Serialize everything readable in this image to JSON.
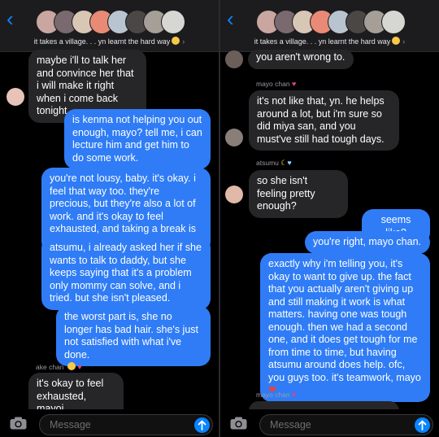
{
  "left": {
    "header": {
      "title": "it takes a village. . . yn learnt the hard way"
    },
    "messages": [
      "maybe i'll to talk her and convince her that i will make it right when i come back tonight.",
      "is kenma not helping you out enough, mayo? tell me, i can lecture him and get him to do some work.",
      "you're not lousy, baby. it's okay. i feel that way too. they're precious, but they're also a lot of work. and it's okay to feel exhausted, and taking a break is also okay.",
      "atsumu, i already asked her if she wants to talk to daddy, but she keeps saying that it's a problem only mommy can solve, and i tried. but she isn't pleased.",
      "the worst part is, she no longer has bad hair. she's just not satisfied with what i've done.",
      "it's okay to feel exhausted, mayoi."
    ],
    "senders": {
      "ake": "ake chan"
    },
    "composer": {
      "placeholder": "Message"
    }
  },
  "right": {
    "header": {
      "title": "it takes a village. . . yn learnt the hard way"
    },
    "messages": [
      "you aren't wrong to.",
      "it's not like that, yn. he helps around a lot, but i'm sure so did miya san, and you must've still had tough days.",
      "so she isn't feeling pretty enough?",
      "seems like?",
      "you're right, mayo chan.",
      "exactly why i'm telling you, it's okay to want to give up. the fact that you actually aren't giving up and still making it work is what matters. having one was tough enough. then we had a second one, and it does get tough for me from time to time, but having atsumu around does help. ofc, you guys too. it's teamwork, mayo"
    ],
    "senders": {
      "mayo1": "mayo chan",
      "atsumu": "atsumu",
      "mayo2": "mayo chan"
    },
    "composer": {
      "placeholder": "Message"
    }
  },
  "colors": {
    "incoming": "#262628",
    "outgoing": "#2f7cf6",
    "accent": "#0a84ff"
  },
  "icons": [
    "back-chevron",
    "camera",
    "send-arrow",
    "heart",
    "crescent-moon",
    "smiling-face"
  ]
}
